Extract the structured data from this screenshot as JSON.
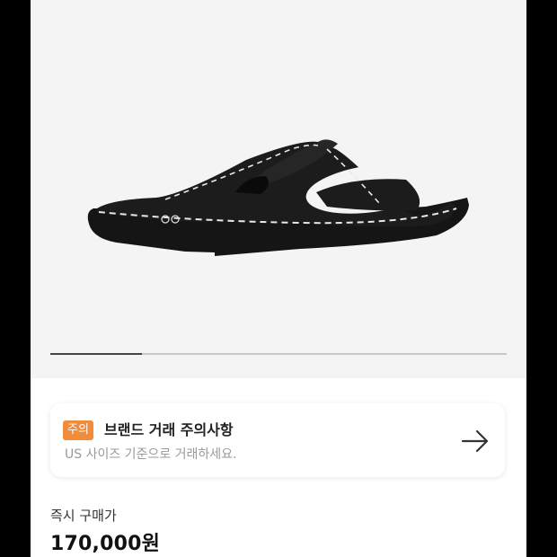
{
  "product": {
    "image_alt": "black flip-flop sandal",
    "logo_mark": "oo",
    "gallery_progress": 0.2
  },
  "notice": {
    "badge": "주의",
    "title": "브랜드 거래 주의사항",
    "subtitle": "US 사이즈 기준으로 거래하세요.",
    "arrow_icon": "arrow-right-icon"
  },
  "price": {
    "label": "즉시 구매가",
    "value": "170,000원"
  },
  "colors": {
    "accent": "#f28c38",
    "hero_bg": "#f4f4f4"
  }
}
